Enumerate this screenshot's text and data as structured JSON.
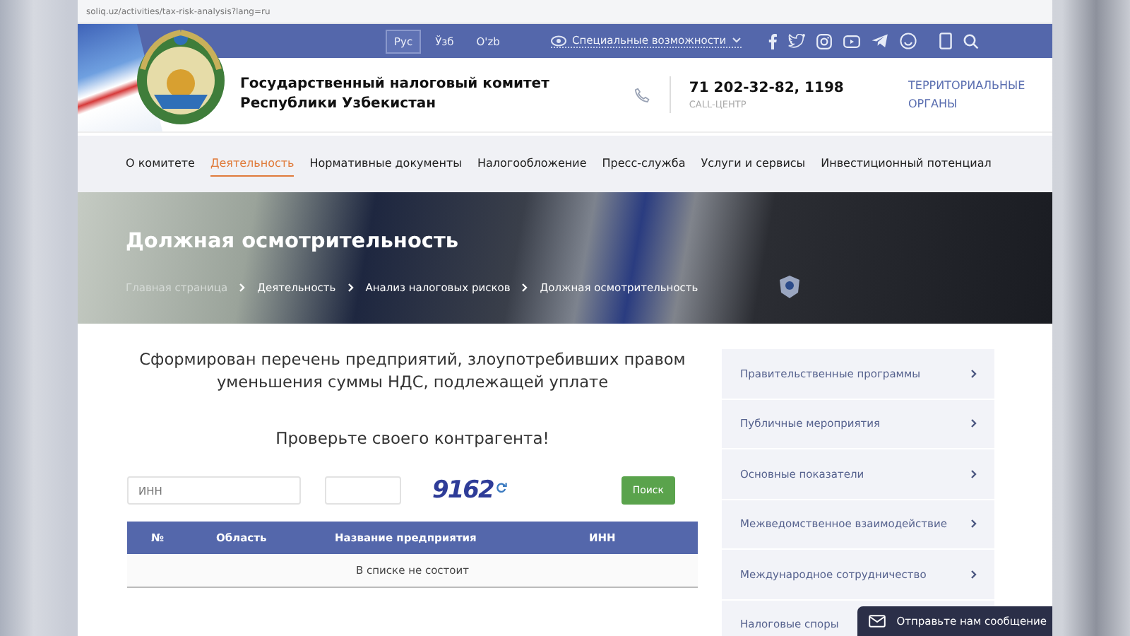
{
  "address_bar": {
    "url": "soliq.uz/activities/tax-risk-analysis?lang=ru"
  },
  "top_bar": {
    "languages": [
      {
        "label": "Рус",
        "selected": true
      },
      {
        "label": "Ўзб",
        "selected": false
      },
      {
        "label": "O'zb",
        "selected": false
      }
    ],
    "accessibility": "Специальные возможности",
    "social": [
      {
        "kind": "facebook"
      },
      {
        "kind": "twitter"
      },
      {
        "kind": "instagram"
      },
      {
        "kind": "youtube"
      },
      {
        "kind": "telegram"
      },
      {
        "kind": "smile"
      }
    ]
  },
  "header": {
    "title_lines": [
      "Государственный налоговый комитет",
      "Республики Узбекистан"
    ],
    "phone": "71 202-32-82, 1198",
    "phone_label": "CALL-ЦЕНТР",
    "territorial": "ТЕРРИТОРИАЛЬНЫЕ ОРГАНЫ"
  },
  "nav": [
    {
      "label": "О комитете",
      "selected": false
    },
    {
      "label": "Деятельность",
      "selected": true
    },
    {
      "label": "Нормативные документы",
      "selected": false
    },
    {
      "label": "Налогообложение",
      "selected": false
    },
    {
      "label": "Пресс-служба",
      "selected": false
    },
    {
      "label": "Услуги и сервисы",
      "selected": false
    },
    {
      "label": "Инвестиционный потенциал",
      "selected": false
    }
  ],
  "hero": {
    "title": "Должная осмотрительность",
    "breadcrumbs": [
      "Главная страница",
      "Деятельность",
      "Анализ налоговых рисков",
      "Должная осмотрительность"
    ]
  },
  "main": {
    "heading": "Сформирован перечень предприятий, злоупотребивших правом уменьшения суммы НДС, подлежащей уплате",
    "subheading": "Проверьте своего контрагента!",
    "inn_field": {
      "placeholder": "ИНН"
    },
    "captcha": "9162",
    "search_button": "Поиск",
    "table": {
      "columns": [
        "№",
        "Область",
        "Название предприятия",
        "ИНН"
      ],
      "empty_message": "В списке не состоит"
    }
  },
  "sidebar": {
    "items": [
      "Правительственные программы",
      "Публичные мероприятия",
      "Основные показатели",
      "Межведомственное взаимодействие",
      "Международное сотрудничество",
      "Налоговые споры"
    ]
  },
  "chat_button": "Отправьте нам сообщение"
}
